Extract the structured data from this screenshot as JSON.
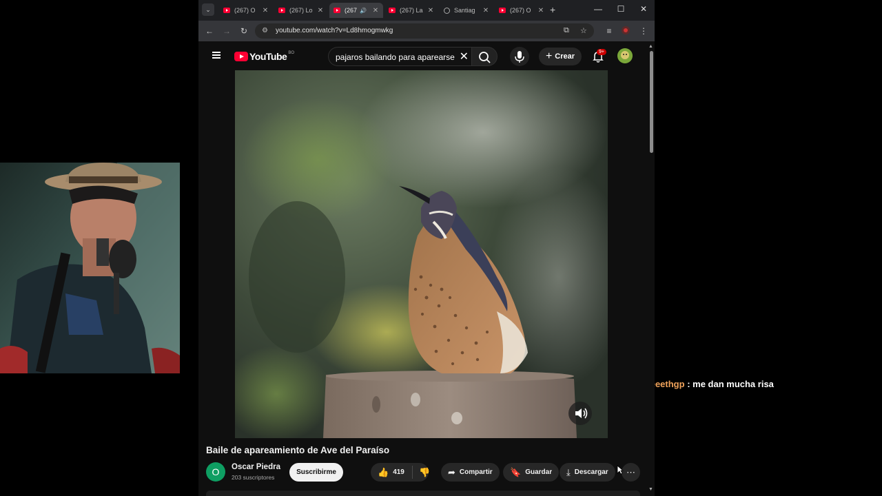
{
  "browser": {
    "tabs": [
      {
        "title": "(267) O",
        "active": false,
        "audio": false,
        "icon": "youtube-icon"
      },
      {
        "title": "(267) Lo",
        "active": false,
        "audio": false,
        "icon": "youtube-icon"
      },
      {
        "title": "(267",
        "active": true,
        "audio": true,
        "icon": "youtube-icon"
      },
      {
        "title": "(267) La",
        "active": false,
        "audio": false,
        "icon": "youtube-icon"
      },
      {
        "title": "Santiag",
        "active": false,
        "audio": false,
        "icon": "globe-icon"
      },
      {
        "title": "(267) O",
        "active": false,
        "audio": false,
        "icon": "youtube-icon"
      }
    ],
    "url": "youtube.com/watch?v=Ld8hmogmwkg"
  },
  "youtube": {
    "logo_text": "YouTube",
    "country_code": "BO",
    "search_query": "pajaros bailando para aparearse",
    "create_label": "Crear",
    "notification_count": "9+",
    "video": {
      "title": "Baile de apareamiento de Ave del Paraíso",
      "channel": "Oscar Piedra",
      "channel_initial": "O",
      "subscribers": "203 suscriptores",
      "subscribe_label": "Suscribirme",
      "likes": "419",
      "share_label": "Compartir",
      "save_label": "Guardar",
      "download_label": "Descargar"
    }
  },
  "chat": {
    "username": "lizeeethgp",
    "separator": " : ",
    "message": "me dan mucha risa"
  },
  "colors": {
    "youtube_red": "#ff0033",
    "chat_username": "#f0a35b",
    "channel_avatar": "#0e9e62"
  }
}
